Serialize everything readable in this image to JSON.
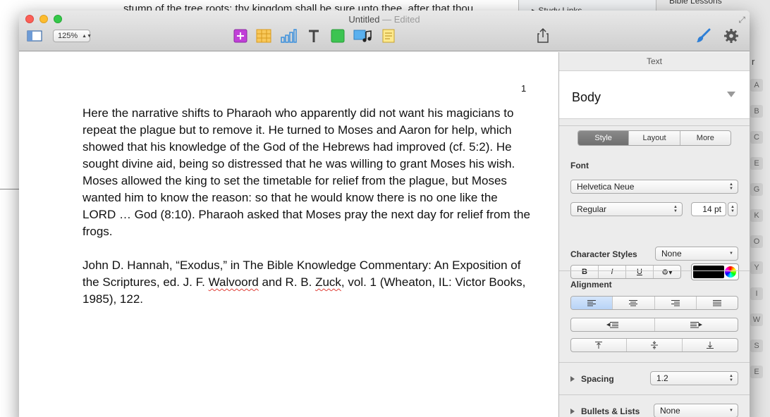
{
  "background": {
    "doc_text": "stump of the tree roots; thy kingdom shall be sure unto thee, after that thou",
    "panel_label": "Study Links",
    "right_label": "Bible Lessons",
    "right_char": "r",
    "index_letters": [
      "A",
      "B",
      "C",
      "E",
      "G",
      "K",
      "O",
      "Y",
      "I",
      "W",
      "S",
      "E"
    ]
  },
  "window": {
    "title": "Untitled",
    "title_suffix": " — Edited",
    "zoom": "125%"
  },
  "toolbar": {
    "icons": [
      "sidebar-icon",
      "comment-icon",
      "table-icon",
      "chart-icon",
      "text-icon",
      "shape-icon",
      "media-icon",
      "note-icon",
      "share-icon",
      "format-brush-icon",
      "gear-icon"
    ]
  },
  "document": {
    "page_number": "1",
    "paragraph1": "Here the narrative shifts to Pharaoh who apparently did not want his magicians to repeat the plague but to remove it. He turned to Moses and Aaron for help, which showed that his knowledge of the God of the Hebrews had improved (cf. 5:2). He sought divine aid, being so distressed that he was willing to grant Moses his wish. Moses allowed the king to set the timetable for relief from the plague, but Moses wanted him to know the reason: so that he would know there is no one like the LORD … God (8:10). Pharaoh asked that Moses pray the next day for relief from the frogs.",
    "paragraph2_a": "John D. Hannah, “Exodus,” in The Bible Knowledge Commentary: An Exposition of the Scriptures, ed. J. F. ",
    "paragraph2_squig1": "Walvoord",
    "paragraph2_b": " and R. B. ",
    "paragraph2_squig2": "Zuck",
    "paragraph2_c": ", vol. 1 (Wheaton, IL: Victor Books, 1985), 122."
  },
  "inspector": {
    "title": "Text",
    "paragraph_style": "Body",
    "tabs": [
      "Style",
      "Layout",
      "More"
    ],
    "active_tab": "Style",
    "font_label": "Font",
    "font_family": "Helvetica Neue",
    "font_typeface": "Regular",
    "font_size": "14 pt",
    "bold": "B",
    "italic": "I",
    "underline": "U",
    "text_color": "#000000",
    "character_styles_label": "Character Styles",
    "character_style": "None",
    "alignment_label": "Alignment",
    "alignment_selected": "left",
    "spacing_label": "Spacing",
    "spacing_value": "1.2",
    "bullets_label": "Bullets & Lists",
    "bullets_value": "None"
  },
  "colors": {
    "accent_selected": "#b8d3f6",
    "toolbar_purple": "#c13fd8",
    "toolbar_orange": "#f4b23a",
    "toolbar_blue": "#3a8fdc",
    "toolbar_green": "#3cc451"
  }
}
